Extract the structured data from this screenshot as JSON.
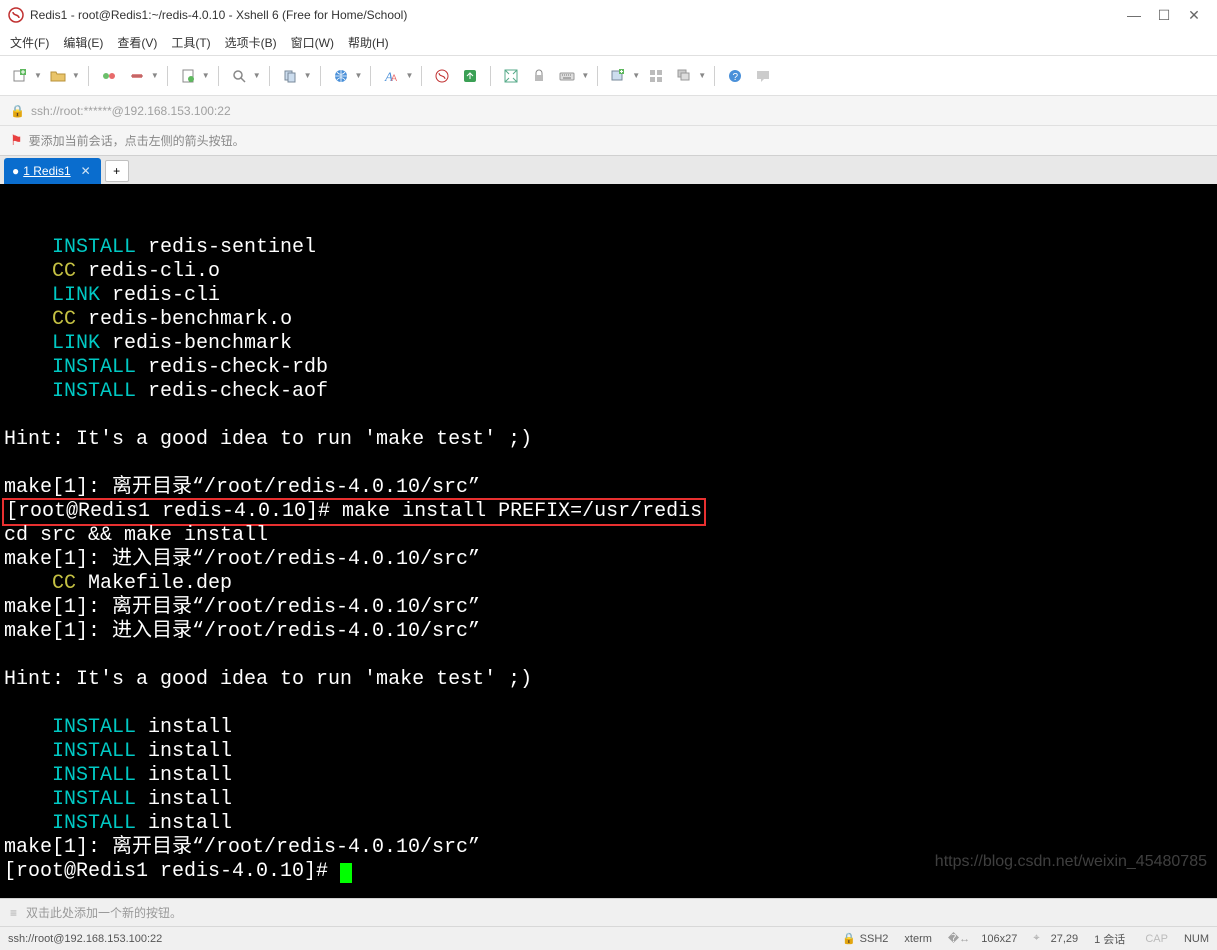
{
  "titlebar": {
    "title": "Redis1 - root@Redis1:~/redis-4.0.10 - Xshell 6 (Free for Home/School)"
  },
  "menu": {
    "items": [
      "文件(F)",
      "编辑(E)",
      "查看(V)",
      "工具(T)",
      "选项卡(B)",
      "窗口(W)",
      "帮助(H)"
    ]
  },
  "addrbar": {
    "url": "ssh://root:******@192.168.153.100:22"
  },
  "hintbar": {
    "text": "要添加当前会话，点击左侧的箭头按钮。"
  },
  "tab": {
    "label": "1 Redis1"
  },
  "terminal": {
    "lines": [
      {
        "type": "kw1",
        "kw": "INSTALL",
        "rest": " redis-sentinel",
        "indent": "    "
      },
      {
        "type": "kw2",
        "kw": "CC",
        "rest": " redis-cli.o",
        "indent": "    "
      },
      {
        "type": "kw1",
        "kw": "LINK",
        "rest": " redis-cli",
        "indent": "    "
      },
      {
        "type": "kw2",
        "kw": "CC",
        "rest": " redis-benchmark.o",
        "indent": "    "
      },
      {
        "type": "kw1",
        "kw": "LINK",
        "rest": " redis-benchmark",
        "indent": "    "
      },
      {
        "type": "kw1",
        "kw": "INSTALL",
        "rest": " redis-check-rdb",
        "indent": "    "
      },
      {
        "type": "kw1",
        "kw": "INSTALL",
        "rest": " redis-check-aof",
        "indent": "    "
      },
      {
        "type": "blank"
      },
      {
        "type": "plain",
        "text": "Hint: It's a good idea to run 'make test' ;)"
      },
      {
        "type": "blank"
      },
      {
        "type": "plain",
        "text": "make[1]: 离开目录“/root/redis-4.0.10/src”"
      },
      {
        "type": "boxed",
        "text": "[root@Redis1 redis-4.0.10]# make install PREFIX=/usr/redis"
      },
      {
        "type": "plain",
        "text": "cd src && make install"
      },
      {
        "type": "plain",
        "text": "make[1]: 进入目录“/root/redis-4.0.10/src”"
      },
      {
        "type": "kw2",
        "kw": "CC",
        "rest": " Makefile.dep",
        "indent": "    "
      },
      {
        "type": "plain",
        "text": "make[1]: 离开目录“/root/redis-4.0.10/src”"
      },
      {
        "type": "plain",
        "text": "make[1]: 进入目录“/root/redis-4.0.10/src”"
      },
      {
        "type": "blank"
      },
      {
        "type": "plain",
        "text": "Hint: It's a good idea to run 'make test' ;)"
      },
      {
        "type": "blank"
      },
      {
        "type": "kw1",
        "kw": "INSTALL",
        "rest": " install",
        "indent": "    "
      },
      {
        "type": "kw1",
        "kw": "INSTALL",
        "rest": " install",
        "indent": "    "
      },
      {
        "type": "kw1",
        "kw": "INSTALL",
        "rest": " install",
        "indent": "    "
      },
      {
        "type": "kw1",
        "kw": "INSTALL",
        "rest": " install",
        "indent": "    "
      },
      {
        "type": "kw1",
        "kw": "INSTALL",
        "rest": " install",
        "indent": "    "
      },
      {
        "type": "plain",
        "text": "make[1]: 离开目录“/root/redis-4.0.10/src”"
      },
      {
        "type": "prompt",
        "text": "[root@Redis1 redis-4.0.10]# "
      }
    ],
    "watermark": "https://blog.csdn.net/weixin_45480785"
  },
  "bottomhint": {
    "text": "双击此处添加一个新的按钮。"
  },
  "statusbar": {
    "left": "ssh://root@192.168.153.100:22",
    "proto": "SSH2",
    "term": "xterm",
    "size": "106x27",
    "pos": "27,29",
    "sess": "1 会话",
    "cap": "CAP",
    "num": "NUM"
  }
}
